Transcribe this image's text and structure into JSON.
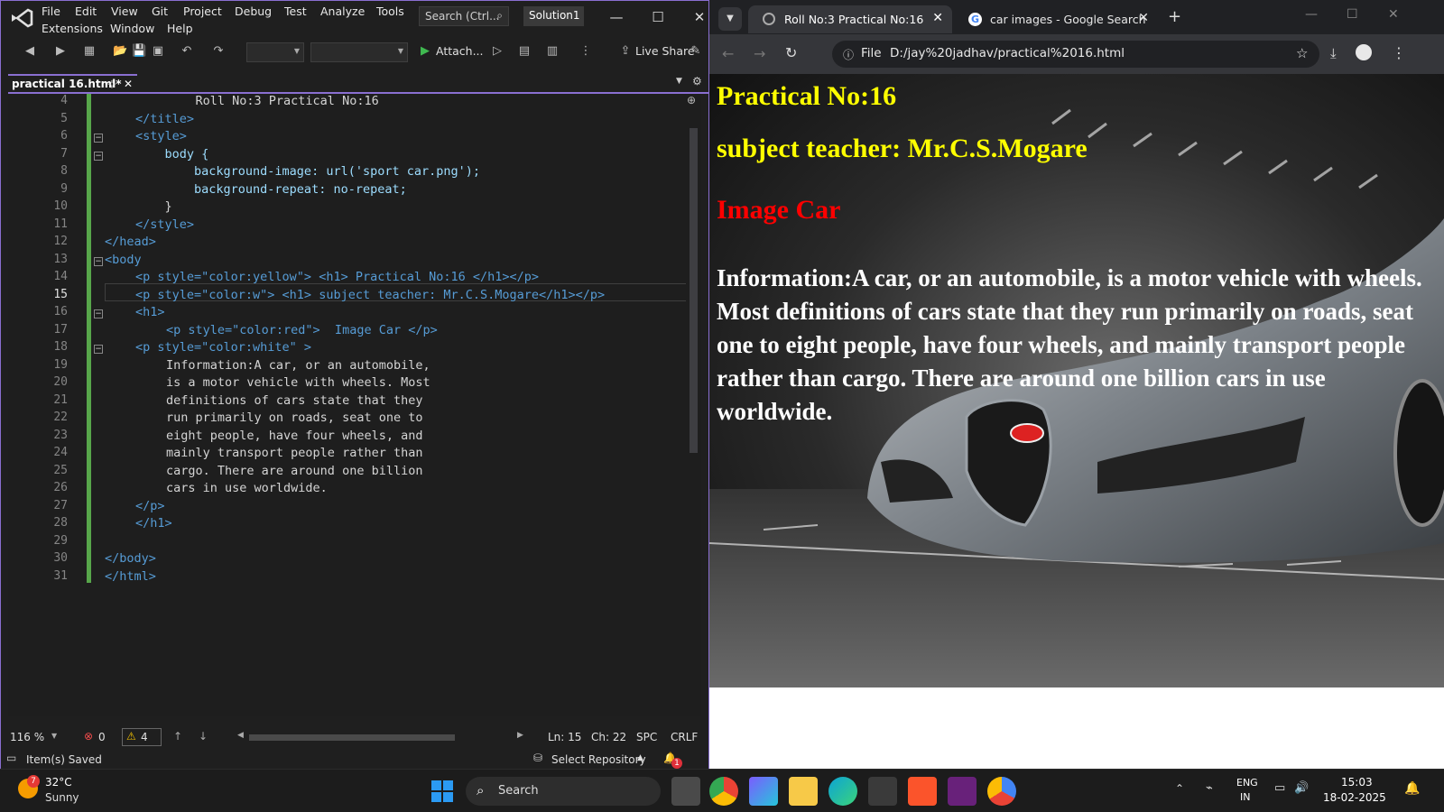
{
  "vs": {
    "menu": [
      "File",
      "Edit",
      "View",
      "Git",
      "Project",
      "Debug",
      "Test",
      "Analyze",
      "Tools",
      "Extensions",
      "Window",
      "Help"
    ],
    "search_placeholder": "Search (Ctrl...",
    "solution": "Solution1",
    "toolbar": {
      "attach": "Attach...",
      "live_share": "Live Share"
    },
    "tab_title": "practical 16.html*",
    "line_numbers": [
      "4",
      "5",
      "6",
      "7",
      "8",
      "9",
      "10",
      "11",
      "12",
      "13",
      "14",
      "15",
      "16",
      "17",
      "18",
      "19",
      "20",
      "21",
      "22",
      "23",
      "24",
      "25",
      "26",
      "27",
      "28",
      "29",
      "30",
      "31"
    ],
    "current_line": "15",
    "status": {
      "zoom": "116 %",
      "errors": "0",
      "warnings": "4",
      "ln": "Ln: 15",
      "ch": "Ch: 22",
      "spc": "SPC",
      "crlf": "CRLF",
      "saved": "Item(s) Saved",
      "select_repo": "Select Repository",
      "notif_count": "1"
    },
    "code": [
      "    Roll No:3 Practical No:16",
      "</title>",
      "<style>",
      "    body {",
      "        background-image: url('sport car.png');",
      "        background-repeat: no-repeat;",
      "    }",
      "</style>",
      "</head>",
      "<body",
      "<p style=\"color:yellow\"> <h1> Practical No:16 </h1></p>",
      "<p style=\"color:w\"> <h1> subject teacher: Mr.C.S.Mogare</h1></p>",
      "<h1>",
      "<p style=\"color:red\">  Image Car </p>",
      "<p style=\"color:white\" >",
      "Information:A car, or an automobile,",
      "is a motor vehicle with wheels. Most",
      "definitions of cars state that they",
      "run primarily on roads, seat one to",
      "eight people, have four wheels, and",
      "mainly transport people rather than",
      "cargo. There are around one billion",
      "cars in use worldwide.",
      "</p>",
      "</h1>",
      "",
      "</body>",
      "</html>"
    ]
  },
  "chrome": {
    "tabs": [
      {
        "label": "Roll No:3 Practical No:16",
        "active": true
      },
      {
        "label": "car images - Google Search",
        "active": false
      }
    ],
    "url_scheme": "File",
    "url": "D:/jay%20jadhav/practical%2016.html",
    "page": {
      "heading1": "Practical No:16",
      "heading2": "subject teacher: Mr.C.S.Mogare",
      "heading3": "Image Car",
      "info": "Information:A car, or an automobile, is a motor vehicle with wheels. Most definitions of cars state that they run primarily on roads, seat one to eight people, have four wheels, and mainly transport people rather than cargo. There are around one billion cars in use worldwide.",
      "colors": {
        "heading1": "#ffff00",
        "heading2": "#ffff00",
        "heading3": "#ff0000",
        "info": "#ffffff"
      }
    }
  },
  "taskbar": {
    "weather_temp": "32°C",
    "weather_desc": "Sunny",
    "weather_badge": "7",
    "search": "Search",
    "lang1": "ENG",
    "lang2": "IN",
    "time": "15:03",
    "date": "18-02-2025"
  }
}
